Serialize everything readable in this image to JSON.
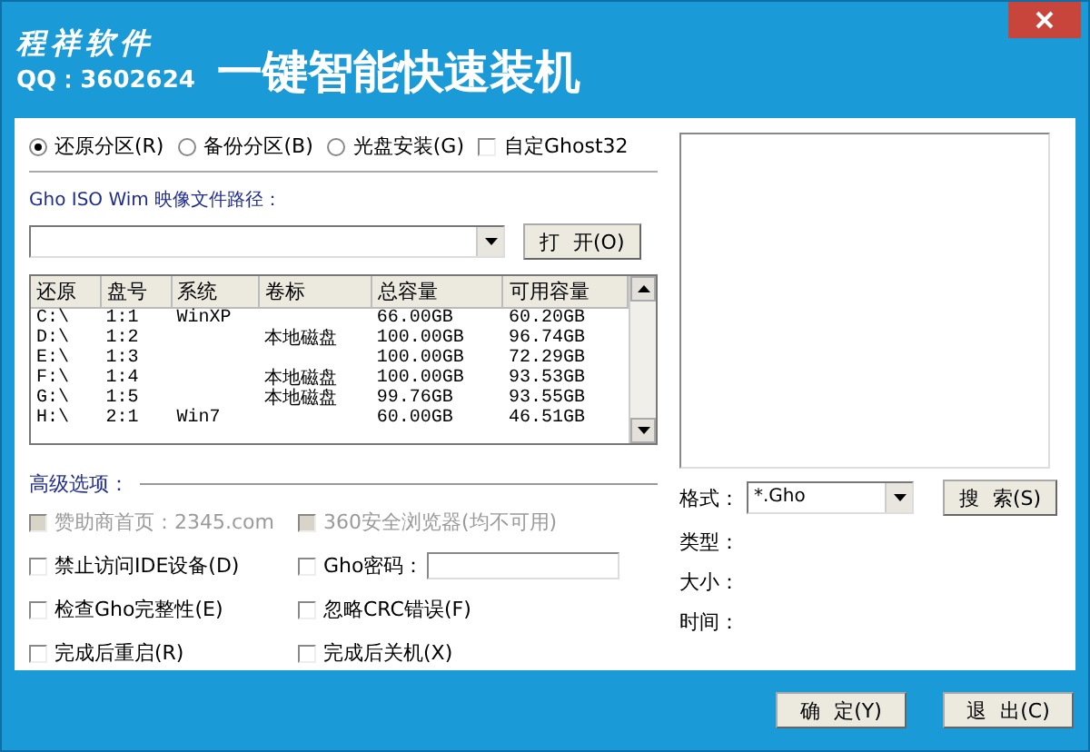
{
  "window": {
    "brand": "程祥软件",
    "qq": "QQ：3602624",
    "title": "一键智能快速装机"
  },
  "modes": [
    {
      "kind": "radio",
      "label": "还原分区(R)",
      "selected": true
    },
    {
      "kind": "radio",
      "label": "备份分区(B)",
      "selected": false
    },
    {
      "kind": "radio",
      "label": "光盘安装(G)",
      "selected": false
    },
    {
      "kind": "checkbox",
      "label": "自定Ghost32",
      "checked": false
    }
  ],
  "path_label": "Gho ISO Wim 映像文件路径：",
  "open_button": "打 开(O)",
  "table": {
    "columns": [
      "还原",
      "盘号",
      "系统",
      "卷标",
      "总容量",
      "可用容量"
    ],
    "rows": [
      [
        "C:\\",
        "1:1",
        "WinXP",
        null,
        "66.00GB",
        "60.20GB"
      ],
      [
        "D:\\",
        "1:2",
        null,
        "本地磁盘",
        "100.00GB",
        "96.74GB"
      ],
      [
        "E:\\",
        "1:3",
        null,
        null,
        "100.00GB",
        "72.29GB"
      ],
      [
        "F:\\",
        "1:4",
        null,
        "本地磁盘",
        "100.00GB",
        "93.53GB"
      ],
      [
        "G:\\",
        "1:5",
        null,
        "本地磁盘",
        "99.76GB",
        "93.55GB"
      ],
      [
        "H:\\",
        "2:1",
        "Win7",
        null,
        "60.00GB",
        "46.51GB"
      ]
    ]
  },
  "advanced_label": "高级选项：",
  "options": [
    {
      "kind": "checkbox",
      "label": "赞助商首页：2345.com",
      "checked": false,
      "disabled": true
    },
    {
      "kind": "checkbox",
      "label": "360安全浏览器(均不可用)",
      "checked": false,
      "disabled": true
    },
    {
      "kind": "checkbox",
      "label": "禁止访问IDE设备(D)",
      "checked": false,
      "disabled": false
    },
    {
      "kind": "password",
      "label": "Gho密码：",
      "checked": false,
      "disabled": false
    },
    {
      "kind": "checkbox",
      "label": "检查Gho完整性(E)",
      "checked": false,
      "disabled": false
    },
    {
      "kind": "checkbox",
      "label": "忽略CRC错误(F)",
      "checked": false,
      "disabled": false
    },
    {
      "kind": "checkbox",
      "label": "完成后重启(R)",
      "checked": false,
      "disabled": false
    },
    {
      "kind": "checkbox",
      "label": "完成后关机(X)",
      "checked": false,
      "disabled": false
    }
  ],
  "format": {
    "label": "格式：",
    "value": "*.Gho"
  },
  "search_button": "搜 索(S)",
  "info": [
    "类型：",
    "大小：",
    "时间："
  ],
  "buttons": [
    "确 定(Y)",
    "退 出(C)"
  ]
}
